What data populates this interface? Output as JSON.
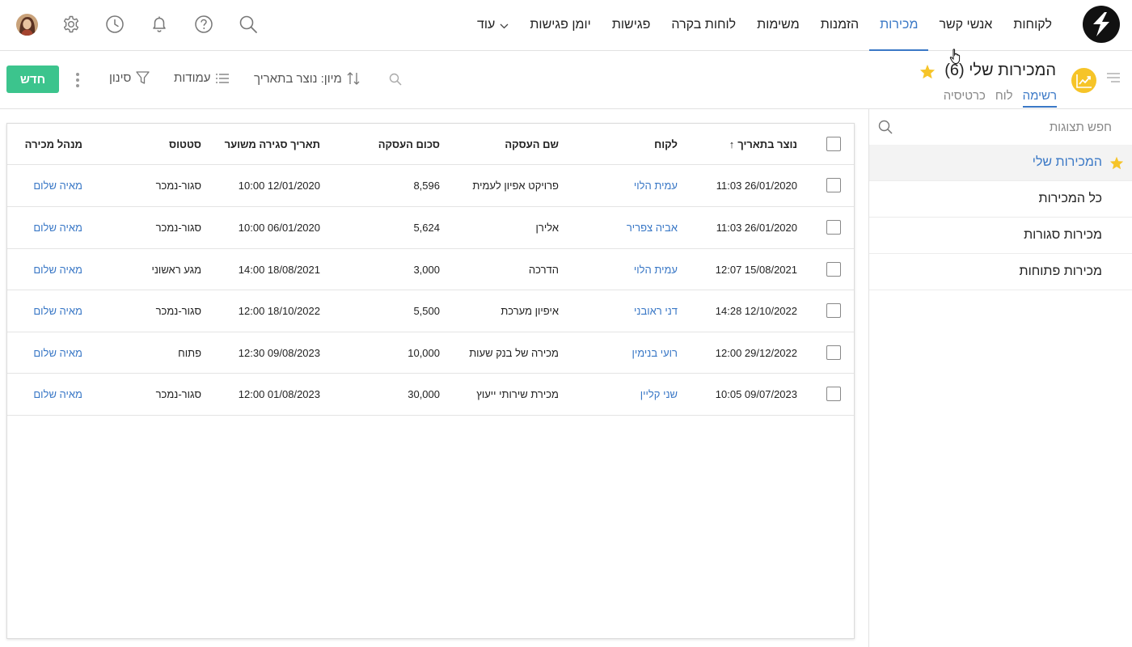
{
  "nav": {
    "items": [
      {
        "label": "לקוחות",
        "active": false
      },
      {
        "label": "אנשי קשר",
        "active": false
      },
      {
        "label": "מכירות",
        "active": true
      },
      {
        "label": "הזמנות",
        "active": false
      },
      {
        "label": "משימות",
        "active": false
      },
      {
        "label": "לוחות בקרה",
        "active": false
      },
      {
        "label": "פגישות",
        "active": false
      },
      {
        "label": "יומן פגישות",
        "active": false
      }
    ],
    "more_label": "עוד",
    "icons": [
      "search-icon",
      "help-icon",
      "bell-icon",
      "clock-icon",
      "gear-icon",
      "avatar"
    ]
  },
  "view": {
    "title": "המכירות שלי",
    "count": "(6)",
    "tabs": [
      {
        "label": "רשימה",
        "active": true
      },
      {
        "label": "לוח",
        "active": false
      },
      {
        "label": "כרטיסיה",
        "active": false
      }
    ]
  },
  "toolbar": {
    "sort_label": "מיון: נוצר בתאריך",
    "columns_label": "עמודות",
    "filter_label": "סינון",
    "new_label": "חדש"
  },
  "sidepanel": {
    "search_placeholder": "חפש תצוגות",
    "items": [
      {
        "label": "המכירות שלי",
        "active": true,
        "starred": true
      },
      {
        "label": "כל המכירות",
        "active": false,
        "starred": false
      },
      {
        "label": "מכירות סגורות",
        "active": false,
        "starred": false
      },
      {
        "label": "מכירות פתוחות",
        "active": false,
        "starred": false
      }
    ]
  },
  "table": {
    "headers": {
      "created": "נוצר בתאריך",
      "created_sort_arrow": "↑",
      "customer": "לקוח",
      "deal_name": "שם העסקה",
      "amount": "סכום העסקה",
      "expected_close": "תאריך סגירה משוער",
      "status": "סטטוס",
      "sales_manager": "מנהל מכירה"
    },
    "rows": [
      {
        "created": "11:03 26/01/2020",
        "customer": "עמית הלוי",
        "deal_name": "פרויקט אפיון לעמית",
        "amount": "8,596",
        "expected_close": "10:00 12/01/2020",
        "status": "סגור-נמכר",
        "sales_manager": "מאיה שלום"
      },
      {
        "created": "11:03 26/01/2020",
        "customer": "אביה צפריר",
        "deal_name": "אלירן",
        "amount": "5,624",
        "expected_close": "10:00 06/01/2020",
        "status": "סגור-נמכר",
        "sales_manager": "מאיה שלום"
      },
      {
        "created": "12:07 15/08/2021",
        "customer": "עמית הלוי",
        "deal_name": "הדרכה",
        "amount": "3,000",
        "expected_close": "14:00 18/08/2021",
        "status": "מגע ראשוני",
        "sales_manager": "מאיה שלום"
      },
      {
        "created": "14:28 12/10/2022",
        "customer": "דני ראובני",
        "deal_name": "איפיון מערכת",
        "amount": "5,500",
        "expected_close": "12:00 18/10/2022",
        "status": "סגור-נמכר",
        "sales_manager": "מאיה שלום"
      },
      {
        "created": "12:00 29/12/2022",
        "customer": "רועי בנימין",
        "deal_name": "מכירה של בנק שעות",
        "amount": "10,000",
        "expected_close": "12:30 09/08/2023",
        "status": "פתוח",
        "sales_manager": "מאיה שלום"
      },
      {
        "created": "10:05 09/07/2023",
        "customer": "שני קליין",
        "deal_name": "מכירת שירותי ייעוץ",
        "amount": "30,000",
        "expected_close": "12:00 01/08/2023",
        "status": "סגור-נמכר",
        "sales_manager": "מאיה שלום"
      }
    ]
  },
  "colors": {
    "accent": "#3a78c6",
    "new_button": "#3cc48d",
    "star": "#f6c428"
  }
}
